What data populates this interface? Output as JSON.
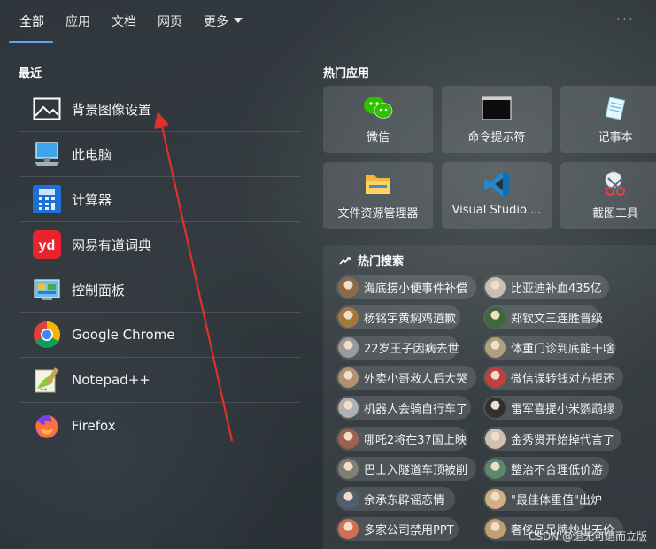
{
  "tabs": [
    {
      "label": "全部",
      "active": true
    },
    {
      "label": "应用"
    },
    {
      "label": "文档"
    },
    {
      "label": "网页"
    },
    {
      "label": "更多"
    }
  ],
  "more_menu": "···",
  "recent": {
    "title": "最近",
    "items": [
      {
        "label": "背景图像设置",
        "icon": "image-settings-icon"
      },
      {
        "label": "此电脑",
        "icon": "computer-icon"
      },
      {
        "label": "计算器",
        "icon": "calculator-icon"
      },
      {
        "label": "网易有道词典",
        "icon": "youdao-dict-icon"
      },
      {
        "label": "控制面板",
        "icon": "control-panel-icon"
      },
      {
        "label": "Google Chrome",
        "icon": "chrome-icon"
      },
      {
        "label": "Notepad++",
        "icon": "notepad-plus-icon"
      },
      {
        "label": "Firefox",
        "icon": "firefox-icon"
      }
    ]
  },
  "hot_apps": {
    "title": "热门应用",
    "items": [
      {
        "label": "微信",
        "icon": "wechat-icon"
      },
      {
        "label": "命令提示符",
        "icon": "cmd-icon"
      },
      {
        "label": "记事本",
        "icon": "notepad-icon"
      },
      {
        "label": "文件资源管理器",
        "icon": "file-explorer-icon"
      },
      {
        "label": "Visual Studio ...",
        "icon": "vscode-icon"
      },
      {
        "label": "截图工具",
        "icon": "snipping-tool-icon"
      }
    ]
  },
  "hot_search": {
    "title": "热门搜索",
    "items": [
      "海底捞小便事件补偿",
      "比亚迪补血435亿",
      "杨铭宇黄焖鸡道歉",
      "郑钦文三连胜晋级",
      "22岁王子因病去世",
      "体重门诊到底能干啥",
      "外卖小哥救人后大哭",
      "微信误转钱对方拒还",
      "机器人会骑自行车了",
      "雷军喜提小米鹦鹉绿",
      "哪吒2将在37国上映",
      "金秀贤开始掉代言了",
      "巴士入隧道车顶被削",
      "整治不合理低价游",
      "余承东辟谣恋情",
      "\"最佳体重值\"出炉",
      "多家公司禁用PPT",
      "奢侈品吊牌炒出天价"
    ]
  },
  "watermark": "CSDN @退无可退而立版",
  "colors": {
    "accent": "#5aa6f0",
    "arrow": "#e0302a"
  }
}
